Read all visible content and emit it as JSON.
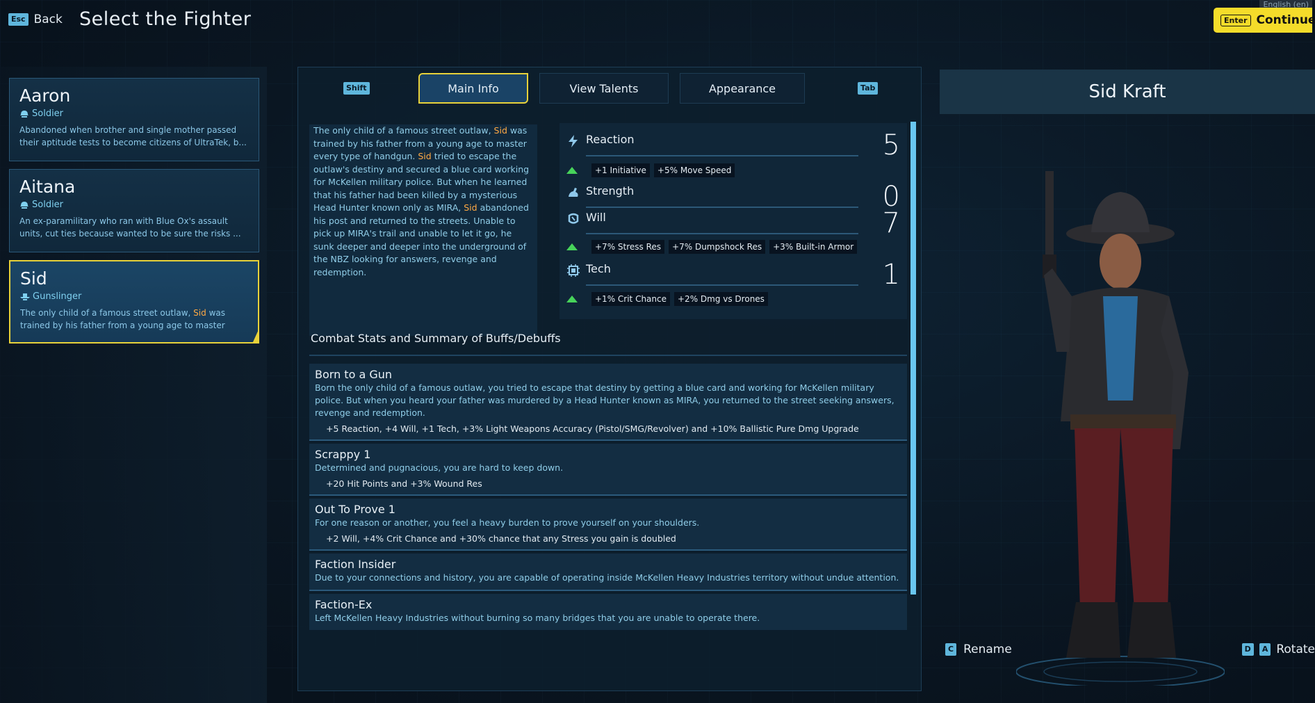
{
  "top": {
    "back_key": "Esc",
    "back_label": "Back",
    "title": "Select the Fighter",
    "language": "English (en)",
    "continue_key": "Enter",
    "continue_label": "Continue"
  },
  "roster": [
    {
      "name": "Aaron",
      "class": "Soldier",
      "desc": "Abandoned when  brother and single mother passed their aptitude tests to become citizens of UltraTek, b..."
    },
    {
      "name": "Aitana",
      "class": "Soldier",
      "desc": "An ex-paramilitary who ran with Blue Ox's assault units,  cut ties because  wanted to be sure the risks ..."
    },
    {
      "name": "Sid",
      "class": "Gunslinger",
      "desc_pre": "The only child of a famous street outlaw, ",
      "desc_hl": "Sid",
      "desc_post": " was trained by his father from a young age to master eve..."
    }
  ],
  "tabs": {
    "left_key": "Shift",
    "main_info": "Main Info",
    "view_talents": "View Talents",
    "appearance": "Appearance",
    "right_key": "Tab"
  },
  "bio": {
    "p1": "The only child of a famous street outlaw, ",
    "name1": "Sid",
    "p2": " was trained by his father from a young age to master every type of handgun. ",
    "name2": "Sid",
    "p3": " tried to escape the outlaw's destiny and secured a blue card working for McKellen military police. But when he learned that his father had been killed by a mysterious Head Hunter known only as MIRA, ",
    "name3": "Sid",
    "p4": " abandoned his post and returned to the streets. Unable to pick up MIRA's trail and unable to let it go, he sunk deeper and deeper into the underground of the NBZ looking for answers, revenge and redemption."
  },
  "attributes": [
    {
      "name": "Reaction",
      "value": "5",
      "icon": "lightning-icon",
      "bonuses": [
        "+1 Initiative",
        "+5% Move Speed"
      ]
    },
    {
      "name": "Strength",
      "value": "0",
      "icon": "flexed-arm-icon",
      "bonuses": []
    },
    {
      "name": "Will",
      "value": "7",
      "icon": "brain-icon",
      "bonuses": [
        "+7% Stress Res",
        "+7% Dumpshock Res",
        "+3% Built-in Armor"
      ]
    },
    {
      "name": "Tech",
      "value": "1",
      "icon": "chip-icon",
      "bonuses": [
        "+1% Crit Chance",
        "+2% Dmg vs Drones"
      ]
    }
  ],
  "combat_title": "Combat Stats and Summary of Buffs/Debuffs",
  "perks": [
    {
      "name": "Born to a Gun",
      "desc": "Born the only child of a famous outlaw, you tried to escape that destiny by getting a blue card and working for McKellen military police. But when you heard your  father was murdered by a Head Hunter known as MIRA, you returned to the street seeking answers, revenge and redemption.",
      "bonus": "+5 Reaction, +4 Will, +1 Tech, +3% Light Weapons Accuracy (Pistol/SMG/Revolver) and +10% Ballistic Pure Dmg Upgrade"
    },
    {
      "name": "Scrappy 1",
      "desc": "Determined and pugnacious, you are hard to keep down.",
      "bonus": "+20 Hit Points and +3% Wound Res"
    },
    {
      "name": "Out To Prove 1",
      "desc": "For one reason or another, you feel a heavy burden to prove yourself on your shoulders.",
      "bonus": "+2 Will, +4% Crit Chance and +30% chance that any Stress you gain is doubled"
    },
    {
      "name": "Faction Insider",
      "desc": "Due to your connections and history, you are capable of operating inside McKellen Heavy Industries territory without undue attention.",
      "bonus": ""
    },
    {
      "name": "Faction-Ex",
      "desc": "Left McKellen Heavy Industries without burning so many bridges that you are unable to operate there.",
      "bonus": ""
    }
  ],
  "character": {
    "full_name": "Sid Kraft",
    "rename_key": "C",
    "rename_label": "Rename",
    "rotate_key_left": "D",
    "rotate_key_right": "A",
    "rotate_label": "Rotate"
  },
  "colors": {
    "accent_yellow": "#e8d23a",
    "highlight_orange": "#ffaa44",
    "text_cyan": "#8cc8e8",
    "buff_green": "#47d35a"
  }
}
